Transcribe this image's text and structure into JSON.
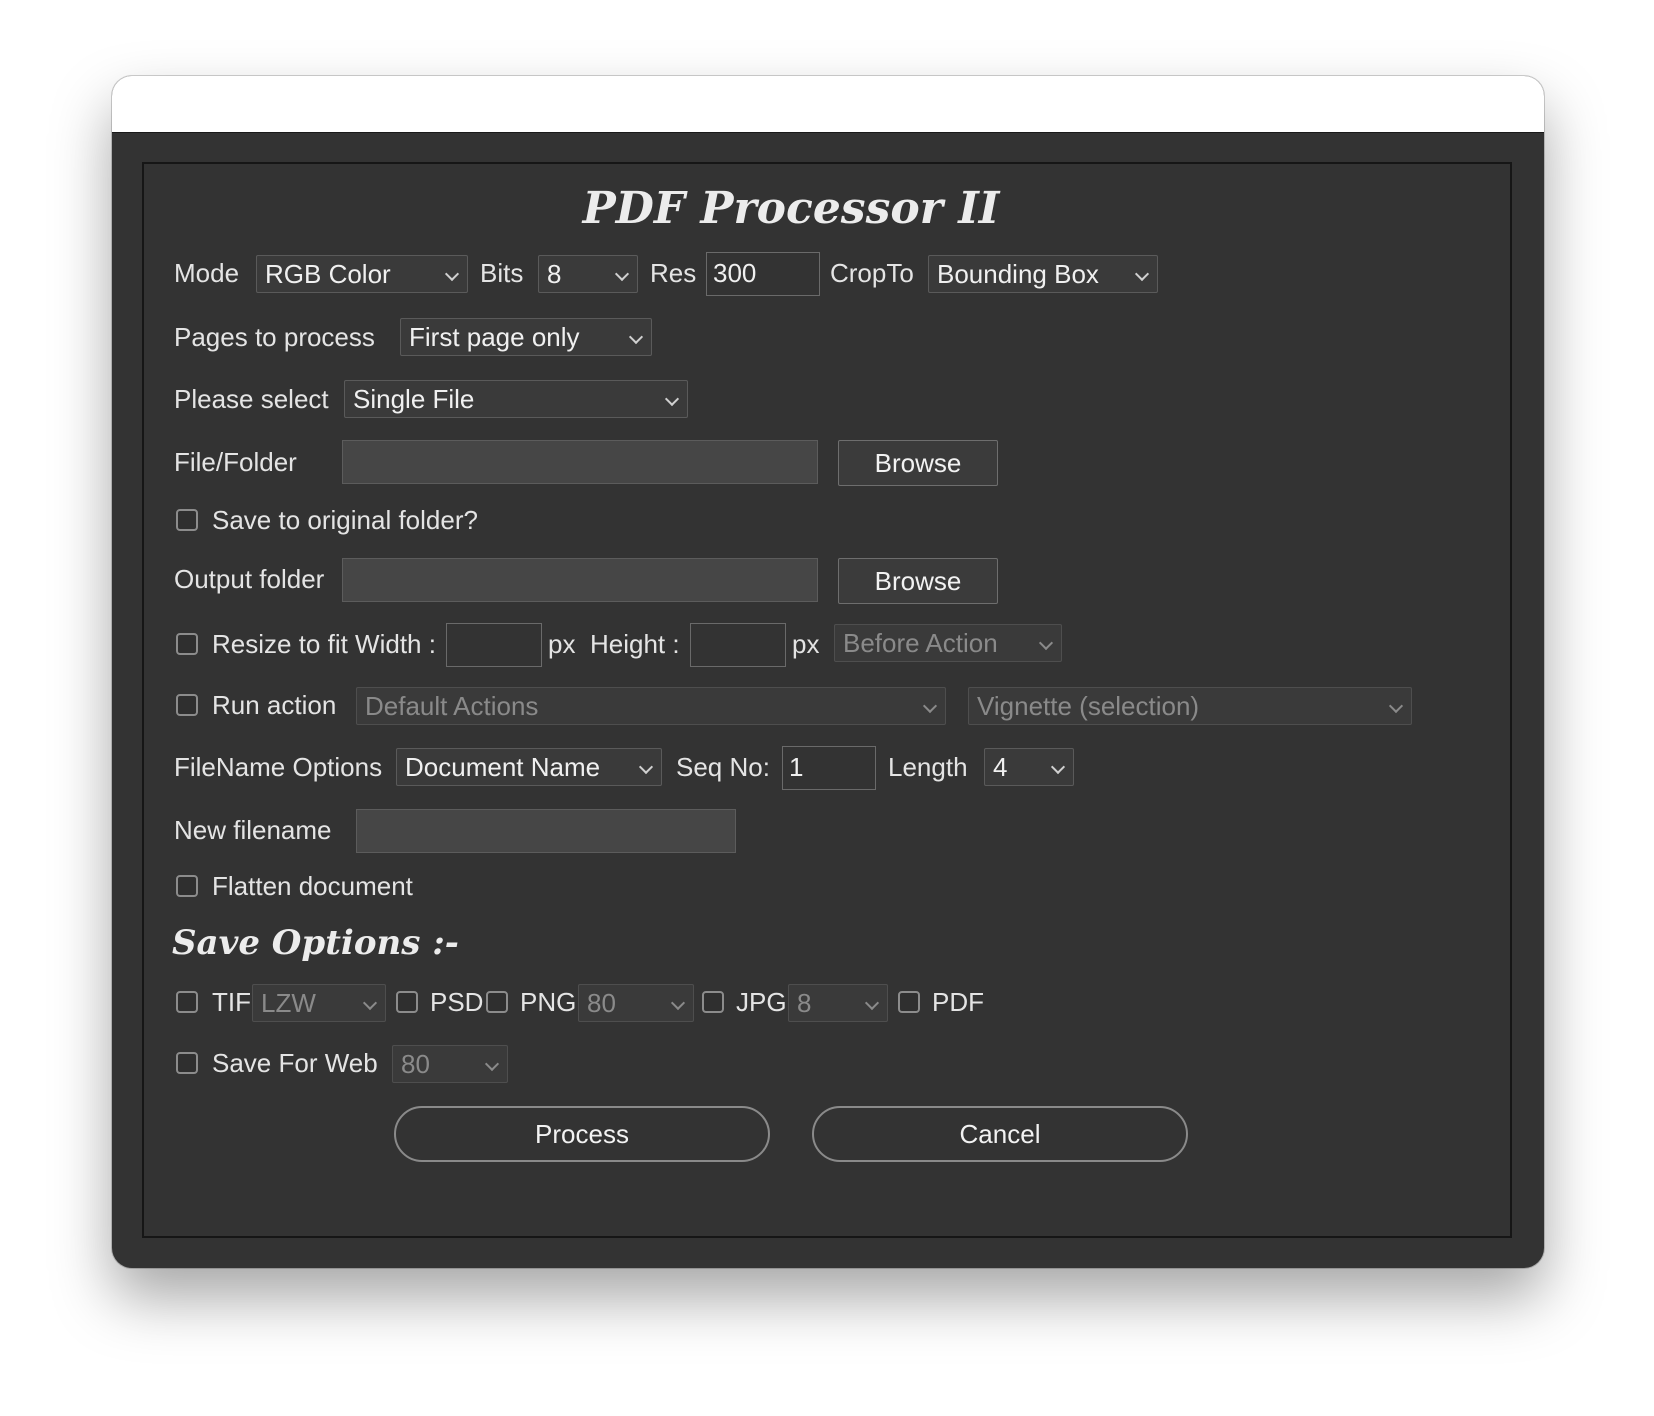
{
  "dialog": {
    "title": "PDF Processor II"
  },
  "row_mode": {
    "mode_label": "Mode",
    "mode_value": "RGB Color",
    "bits_label": "Bits",
    "bits_value": "8",
    "res_label": "Res",
    "res_value": "300",
    "cropto_label": "CropTo",
    "cropto_value": "Bounding Box"
  },
  "pages": {
    "label": "Pages to process",
    "value": "First page only"
  },
  "select": {
    "label": "Please select",
    "value": "Single File"
  },
  "file_folder": {
    "label": "File/Folder",
    "value": "",
    "browse_label": "Browse"
  },
  "save_original": {
    "label": "Save to original folder?",
    "checked": false
  },
  "output_folder": {
    "label": "Output folder",
    "value": "",
    "browse_label": "Browse"
  },
  "resize": {
    "label": "Resize to fit Width :",
    "width_value": "",
    "px1": "px",
    "height_label": "Height :",
    "height_value": "",
    "px2": "px",
    "timing_value": "Before Action",
    "checked": false
  },
  "run_action": {
    "label": "Run action",
    "set_value": "Default Actions",
    "action_value": "Vignette (selection)",
    "checked": false
  },
  "filename": {
    "label": "FileName Options",
    "value": "Document Name",
    "seq_label": "Seq No:",
    "seq_value": "1",
    "length_label": "Length",
    "length_value": "4"
  },
  "new_filename": {
    "label": "New filename",
    "value": ""
  },
  "flatten": {
    "label": "Flatten document",
    "checked": false
  },
  "save_options": {
    "heading": "Save Options :-",
    "tif_label": "TIF",
    "tif_compression": "LZW",
    "psd_label": "PSD",
    "png_label": "PNG",
    "png_quality": "80",
    "jpg_label": "JPG",
    "jpg_quality": "8",
    "pdf_label": "PDF",
    "web_label": "Save For Web",
    "web_quality": "80"
  },
  "buttons": {
    "process": "Process",
    "cancel": "Cancel"
  }
}
